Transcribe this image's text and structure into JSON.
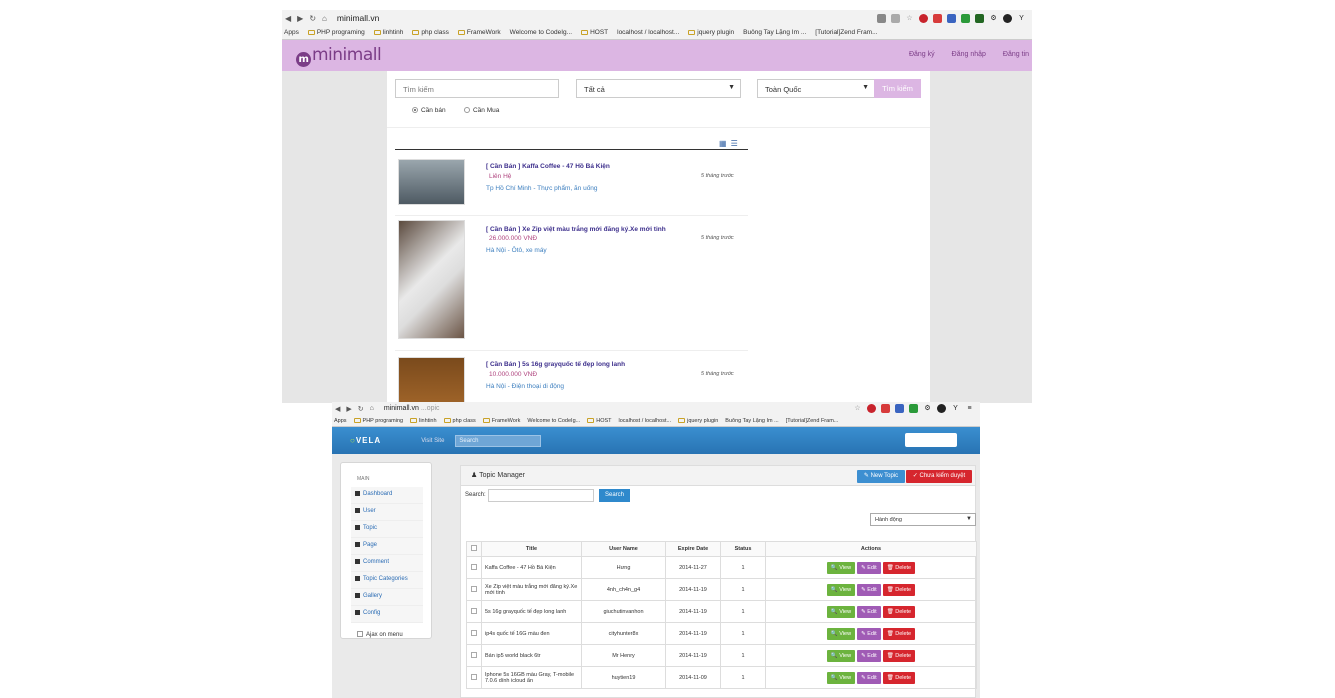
{
  "minimall": {
    "url": "minimall.vn",
    "bookmarks": [
      "Apps",
      "PHP programing",
      "linhtinh",
      "php class",
      "FrameWork",
      "Welcome to CodeIg...",
      "HOST",
      "localhost / localhost...",
      "jquery plugin",
      "Buông Tay Lặng Im ...",
      "[Tutorial]Zend Fram..."
    ],
    "logo": "minimall",
    "links": {
      "register": "Đăng ký",
      "login": "Đăng nhập",
      "post": "Đăng tin"
    },
    "search": {
      "placeholder": "Tìm kiếm",
      "category": "Tất cả",
      "region": "Toàn Quốc",
      "button": "Tìm kiếm"
    },
    "radios": {
      "sell": "Cần bán",
      "buy": "Cần Mua"
    },
    "items": [
      {
        "title": "[ Cần Bán ] Kaffa Coffee - 47 Hồ Bá Kiện",
        "price": "Liên Hệ",
        "location": "Tp Hồ Chí Minh - Thực phẩm, ăn uống",
        "time": "5 tháng trước"
      },
      {
        "title": "[ Cần Bán ] Xe Zip việt màu trắng mới đăng ký.Xe mới tinh",
        "price": "26.000.000 VNĐ",
        "location": "Hà Nội - Ôtô, xe máy",
        "time": "5 tháng trước"
      },
      {
        "title": "[ Cần Bán ] 5s 16g grayquốc tế đẹp long lanh",
        "price": "10.000.000 VNĐ",
        "location": "Hà Nội - Điện thoại di động",
        "time": "5 tháng trước"
      }
    ]
  },
  "admin": {
    "url": "minimall.vn",
    "url_suffix": "...opic",
    "bookmarks": [
      "Apps",
      "PHP programing",
      "linhtinh",
      "php class",
      "FrameWork",
      "Welcome to CodeIg...",
      "HOST",
      "localhost / localhost...",
      "jquery plugin",
      "Buông Tay Lặng Im ...",
      "[Tutorial]Zend Fram..."
    ],
    "logo": "VELA",
    "visit_site": "Visit Site",
    "search_placeholder": "Search",
    "sidebar": {
      "heading": "MAIN",
      "items": [
        "Dashboard",
        "User",
        "Topic",
        "Page",
        "Comment",
        "Topic Categories",
        "Gallery",
        "Config"
      ],
      "ajax": "Ajax on menu"
    },
    "panel": {
      "title": "Topic Manager",
      "new_topic": "New Topic",
      "unapproved": "Chưa kiểm duyệt",
      "search_label": "Search:",
      "search_button": "Search",
      "action_select": "Hành động"
    },
    "table": {
      "headers": [
        "Title",
        "User Name",
        "Expire Date",
        "Status",
        "Actions"
      ],
      "actions": {
        "view": "View",
        "edit": "Edit",
        "delete": "Delete"
      },
      "rows": [
        {
          "title": "Kaffa Coffee - 47 Hồ Bá Kiện",
          "user": "Hưng",
          "date": "2014-11-27",
          "status": "1"
        },
        {
          "title": "Xe Zip việt màu trắng mới đăng ký.Xe mới tinh",
          "user": "4nh_ch4n_g4",
          "date": "2014-11-19",
          "status": "1"
        },
        {
          "title": "5s 16g grayquốc tế đẹp long lanh",
          "user": "giuchutinvanhon",
          "date": "2014-11-19",
          "status": "1"
        },
        {
          "title": "ip4s quốc tế 16G màu đen",
          "user": "cityhunter8x",
          "date": "2014-11-19",
          "status": "1"
        },
        {
          "title": "Bán ip5 world black 6tr",
          "user": "Mr Henry",
          "date": "2014-11-19",
          "status": "1"
        },
        {
          "title": "Iphone 5s 16GB màu Gray, T-mobile 7.0.6 dính icloud ẩn",
          "user": "huytien19",
          "date": "2014-11-09",
          "status": "1"
        }
      ]
    }
  }
}
